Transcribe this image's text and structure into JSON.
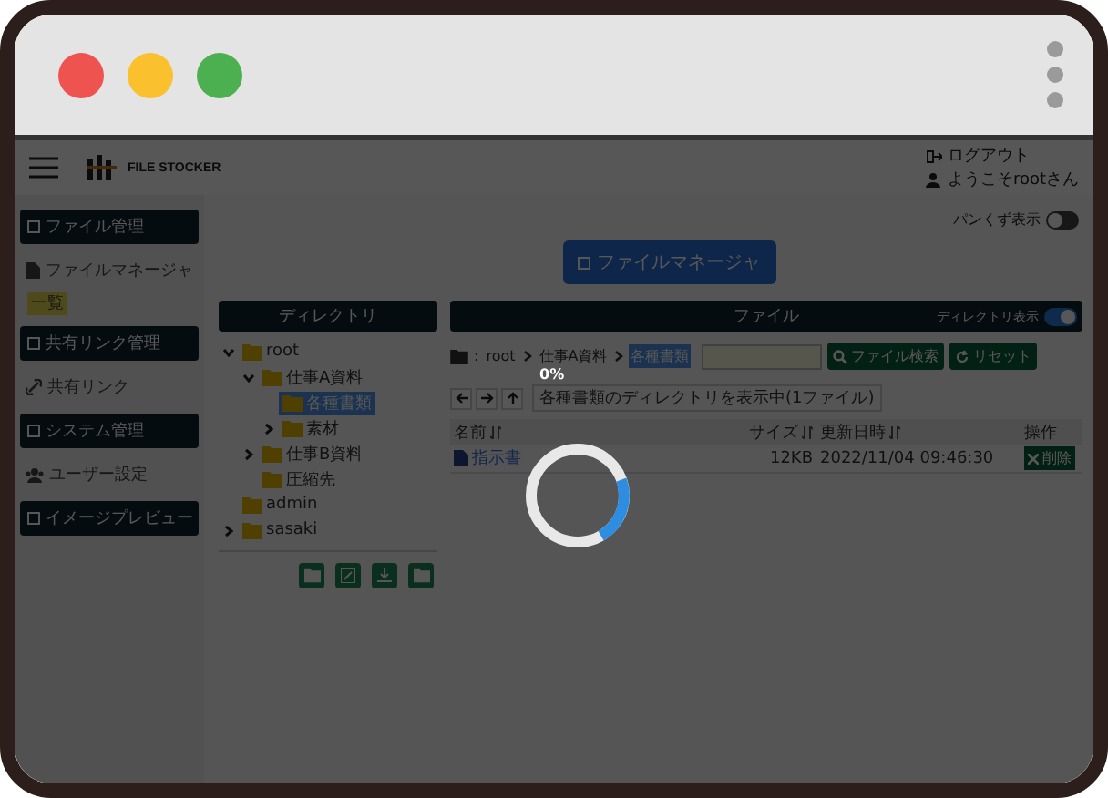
{
  "header": {
    "logo_text": "FILE STOCKER",
    "logout": "ログアウト",
    "welcome": "ようこそrootさん"
  },
  "sidebar": {
    "sections": [
      {
        "title": "ファイル管理",
        "items": [
          {
            "label": "ファイルマネージャ",
            "kind": "file",
            "children": [
              {
                "label": "一覧",
                "selected": true
              }
            ]
          }
        ]
      },
      {
        "title": "共有リンク管理",
        "items": [
          {
            "label": "共有リンク",
            "kind": "link"
          }
        ]
      },
      {
        "title": "システム管理",
        "items": [
          {
            "label": "ユーザー設定",
            "kind": "users"
          }
        ]
      },
      {
        "title": "イメージプレビュー"
      }
    ]
  },
  "breadcrumb_toggle": {
    "label": "パンくず表示",
    "on": false
  },
  "page_button": "ファイルマネージャ",
  "directory": {
    "title": "ディレクトリ",
    "tree": [
      {
        "label": "root",
        "expanded": true,
        "selected": false,
        "children": [
          {
            "label": "仕事A資料",
            "expanded": true,
            "selected": false,
            "children": [
              {
                "label": "各種書類",
                "selected": true
              },
              {
                "label": "素材",
                "expanded": false,
                "selected": false
              }
            ]
          },
          {
            "label": "仕事B資料",
            "expanded": false,
            "selected": false
          },
          {
            "label": "圧縮先",
            "selected": false
          }
        ]
      },
      {
        "label": "admin",
        "selected": false
      },
      {
        "label": "sasaki",
        "expanded": false,
        "selected": false
      }
    ]
  },
  "files": {
    "title": "ファイル",
    "dir_toggle": {
      "label": "ディレクトリ表示",
      "on": true
    },
    "breadcrumb_prefix": ":",
    "breadcrumb": [
      {
        "label": "root",
        "selected": false
      },
      {
        "label": "仕事A資料",
        "selected": false
      },
      {
        "label": "各種書類",
        "selected": true
      }
    ],
    "search_button": "ファイル検索",
    "reset_button": "リセット",
    "status": "各種書類のディレクトリを表示中(1ファイル)",
    "columns": [
      {
        "label": "名前",
        "sortable": true
      },
      {
        "label": "サイズ",
        "sortable": true
      },
      {
        "label": "更新日時",
        "sortable": true
      },
      {
        "label": "操作",
        "sortable": false
      }
    ],
    "rows": [
      {
        "name": "指示書",
        "size": "12KB",
        "modified": "2022/11/04 09:46:30",
        "action": "削除"
      }
    ]
  },
  "loading": {
    "label": "0%"
  }
}
